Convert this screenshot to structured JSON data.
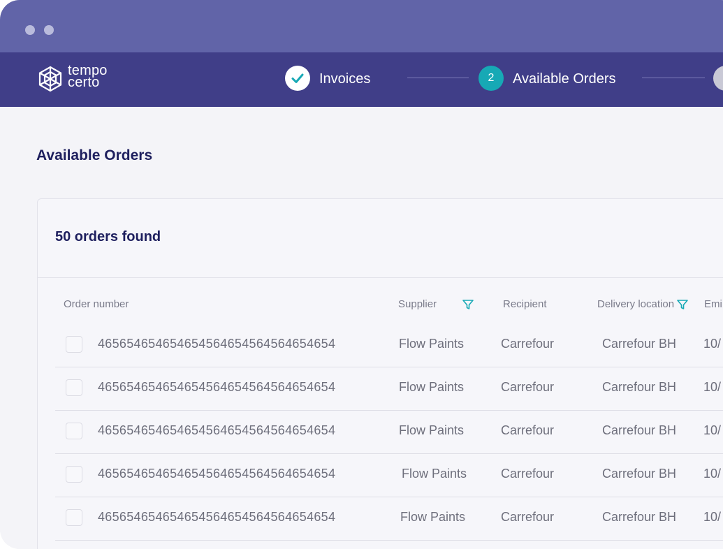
{
  "steps": [
    {
      "label": "Invoices",
      "state": "done",
      "icon": "check-icon"
    },
    {
      "number": "2",
      "label": "Available Orders",
      "state": "active"
    }
  ],
  "logo": {
    "line1": "tempo",
    "line2": "certo"
  },
  "page_title": "Available Orders",
  "orders_found": "50 orders found",
  "columns": {
    "order_number": "Order number",
    "supplier": "Supplier",
    "recipient": "Recipient",
    "delivery_location": "Delivery location",
    "emission": "Emi"
  },
  "rows": [
    {
      "order": "46565465465465456465456456465465​4",
      "supplier": "Flow Paints",
      "recipient": "Carrefour",
      "location": "Carrefour BH",
      "date": "10/"
    },
    {
      "order": "465654654654654564654564564654654",
      "supplier": "Flow Paints",
      "recipient": "Carrefour",
      "location": "Carrefour BH",
      "date": "10/"
    },
    {
      "order": "465654654654654564654564564654654",
      "supplier": "Flow Paints",
      "recipient": "Carrefour",
      "location": "Carrefour BH",
      "date": "10/"
    },
    {
      "order": "465654654654654564654564564654654",
      "supplier": "Flow Paints",
      "recipient": "Carrefour",
      "location": "Carrefour BH",
      "date": "10/"
    },
    {
      "order": "465654654654654564654564564654654",
      "supplier": "Flow Paints",
      "recipient": "Carrefour",
      "location": "Carrefour BH",
      "date": "10/"
    }
  ],
  "colors": {
    "titlebar": "#6164a8",
    "appbar": "#403e88",
    "accent_teal": "#17a9b5",
    "heading": "#1e1f5e"
  }
}
